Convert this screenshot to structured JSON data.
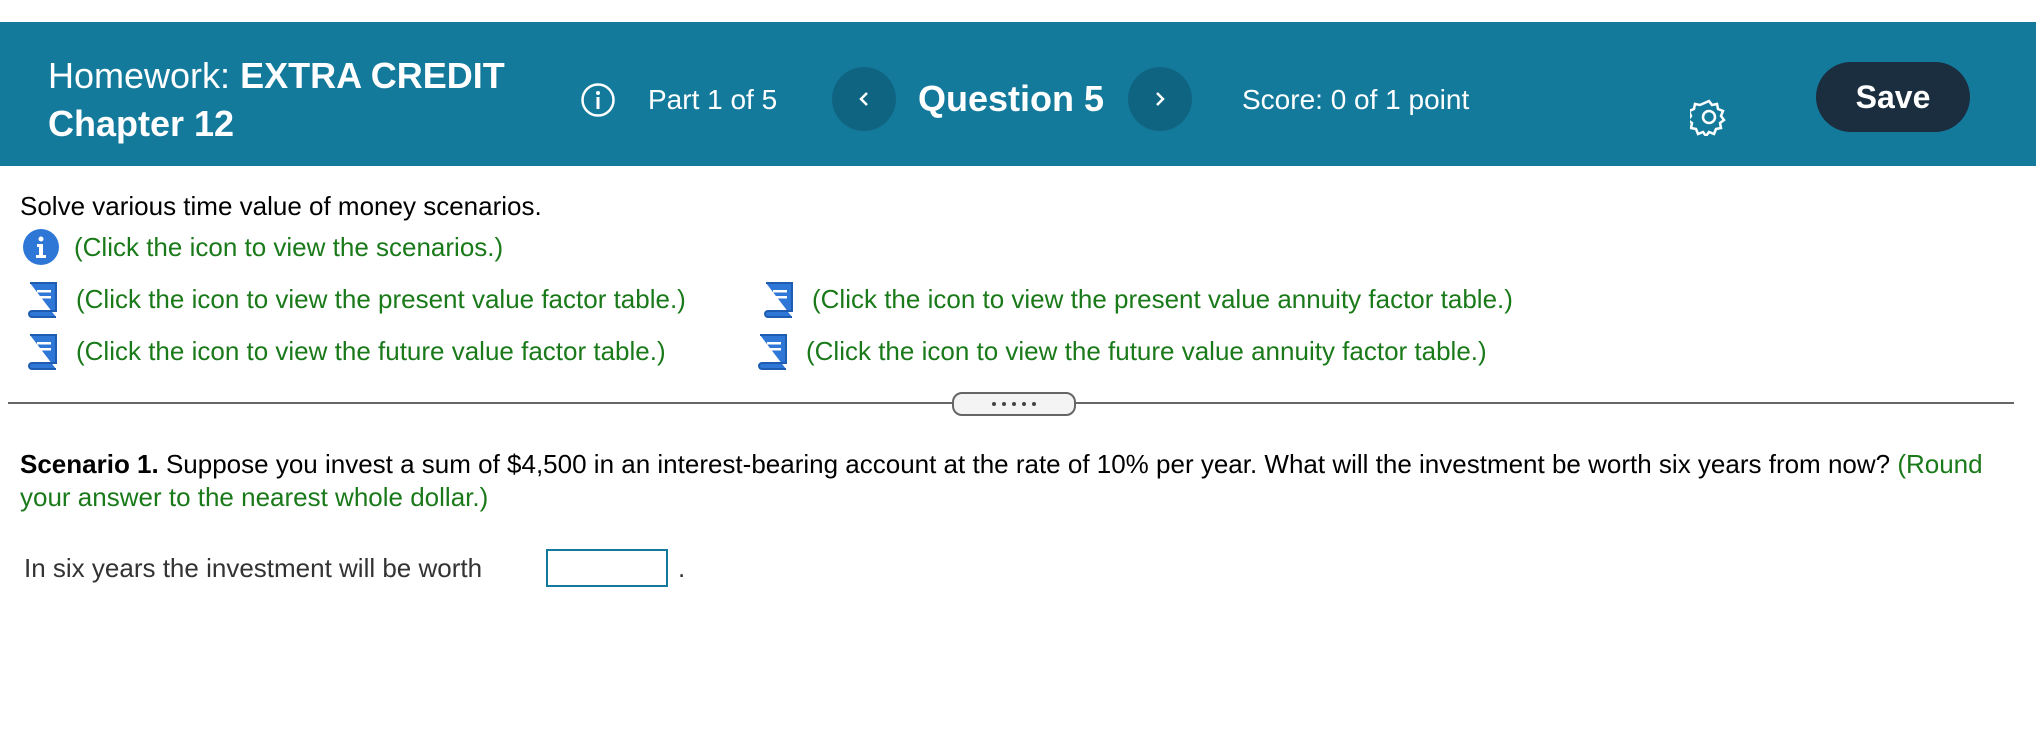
{
  "header": {
    "homework_prefix": "Homework:",
    "homework_name": "EXTRA CREDIT",
    "chapter": "Chapter 12",
    "part": "Part 1 of 5",
    "question": "Question 5",
    "score": "Score: 0 of 1 point",
    "save_label": "Save"
  },
  "content": {
    "intro": "Solve various time value of money scenarios.",
    "links": {
      "scenarios": "(Click the icon to view the scenarios.)",
      "pv_factor": "(Click the icon to view the present value factor table.)",
      "pva_factor": "(Click the icon to view the present value annuity factor table.)",
      "fv_factor": "(Click the icon to view the future value factor table.)",
      "fva_factor": "(Click the icon to view the future value annuity factor table.)"
    },
    "scenario": {
      "label": "Scenario 1.",
      "text": " Suppose you invest a sum of $4,500 in an interest-bearing account at the rate of 10% per year. What will the investment be worth six years from now? ",
      "hint": "(Round your answer to the nearest whole dollar.)"
    },
    "answer": {
      "label": "In six years the investment will be worth",
      "value": "",
      "period": "."
    }
  },
  "colors": {
    "header_bg": "#147a9c",
    "nav_btn_bg": "#0f6482",
    "save_bg": "#1b2e3f",
    "link_green": "#1a7a1a",
    "icon_blue": "#2f77d6"
  },
  "icons": [
    "info-circle-icon",
    "chevron-left-icon",
    "chevron-right-icon",
    "gear-icon",
    "info-icon",
    "book-icon"
  ]
}
